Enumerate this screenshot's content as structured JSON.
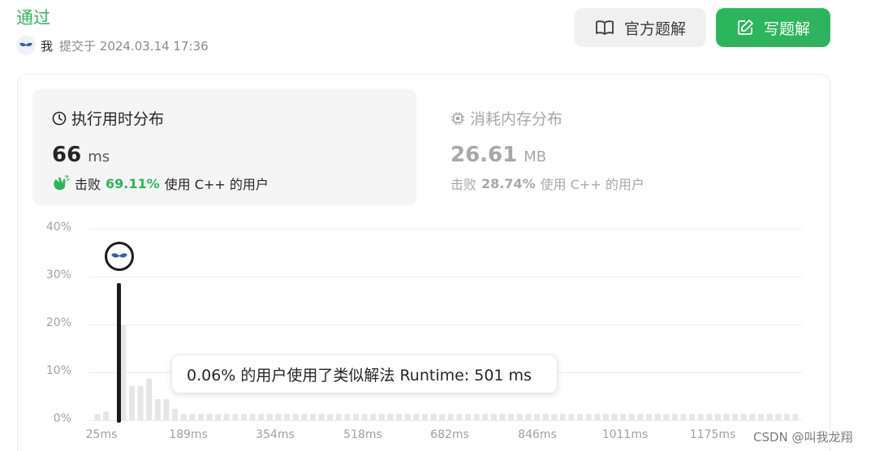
{
  "header": {
    "status": "通过",
    "submitter": "我",
    "submitted_at": "提交于 2024.03.14 17:36"
  },
  "actions": {
    "official_solution": "官方题解",
    "write_solution": "写题解"
  },
  "runtime": {
    "title": "执行用时分布",
    "value": "66",
    "unit": "ms",
    "beat_prefix": "击败",
    "beat_percent": "69.11%",
    "beat_suffix": "使用 C++ 的用户"
  },
  "memory": {
    "title": "消耗内存分布",
    "value": "26.61",
    "unit": "MB",
    "beat_prefix": "击败",
    "beat_percent": "28.74%",
    "beat_suffix": "使用 C++ 的用户"
  },
  "tooltip": {
    "text": "0.06% 的用户使用了类似解法 Runtime: 501 ms"
  },
  "watermark": "CSDN @叫我龙翔",
  "colors": {
    "accent_green": "#2db55d",
    "bar_gray": "#e6e6e6",
    "marker": "#1a1a1a",
    "avatar_blue": "#3b5bb5"
  },
  "chart_data": {
    "type": "bar",
    "title": "执行用时分布",
    "xlabel": "",
    "ylabel": "",
    "y_ticks": [
      "0%",
      "10%",
      "20%",
      "30%",
      "40%"
    ],
    "ylim": [
      0,
      40
    ],
    "x_ticks": [
      "25ms",
      "189ms",
      "354ms",
      "518ms",
      "682ms",
      "846ms",
      "1011ms",
      "1175ms"
    ],
    "bar_count": 82,
    "values": [
      1.3,
      1.8,
      28.5,
      20,
      7.2,
      7.2,
      8.7,
      4.4,
      4.4,
      2.4,
      1.3,
      1.3,
      1.3,
      1.3,
      1.3,
      1.3,
      1.3,
      1.3,
      1.3,
      1.3,
      1.3,
      1.3,
      1.3,
      1.3,
      1.3,
      1.3,
      1.3,
      1.3,
      1.3,
      1.3,
      1.3,
      1.3,
      1.3,
      1.3,
      1.3,
      1.3,
      1.3,
      1.3,
      1.3,
      1.3,
      1.3,
      1.3,
      1.3,
      1.3,
      1.3,
      1.3,
      1.3,
      1.3,
      1.3,
      1.3,
      1.3,
      1.3,
      1.3,
      1.3,
      1.3,
      1.3,
      1.3,
      1.3,
      1.3,
      1.3,
      1.3,
      1.3,
      1.3,
      1.3,
      1.3,
      1.3,
      1.3,
      1.3,
      1.3,
      1.3,
      1.3,
      1.3,
      1.3,
      1.3,
      1.3,
      1.3,
      1.3,
      1.3,
      1.3,
      1.3,
      1.3,
      1.3
    ],
    "highlight_index": 2,
    "grid": true
  }
}
